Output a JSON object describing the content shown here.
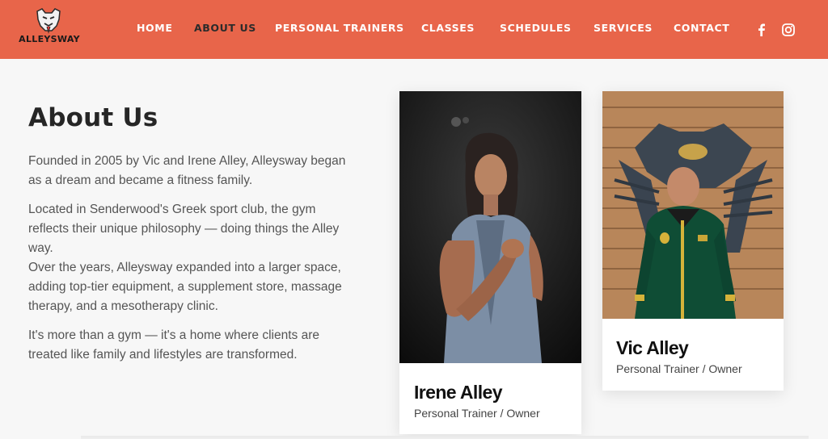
{
  "header": {
    "brand": "ALLEYSWAY",
    "nav": [
      "HOME",
      "ABOUT US",
      "PERSONAL TRAINERS",
      "CLASSES",
      "SCHEDULES",
      "SERVICES",
      "CONTACT"
    ],
    "active": "ABOUT US",
    "social": [
      "facebook-icon",
      "instagram-icon"
    ],
    "bg_color": "#e8654a"
  },
  "about": {
    "title": "About Us",
    "paragraphs": [
      "Founded in 2005 by Vic and Irene Alley, Alleysway began as a dream and became a fitness family.",
      "Located in Senderwood's Greek sport club, the gym reflects their unique philosophy — doing things the Alley way.",
      "Over the years, Alleysway expanded into a larger space, adding top-tier equipment, a supplement store, massage therapy, and a mesotherapy clinic.",
      "It's more than a gym — it's a home where clients are treated like family and lifestyles are transformed."
    ]
  },
  "team": [
    {
      "name": "Irene Alley",
      "role": "Personal Trainer / Owner"
    },
    {
      "name": "Vic Alley",
      "role": "Personal Trainer / Owner"
    }
  ]
}
